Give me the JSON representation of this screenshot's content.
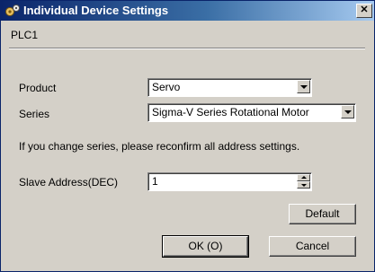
{
  "window": {
    "title": "Individual Device Settings",
    "close_glyph": "✕"
  },
  "plc_name": "PLC1",
  "product": {
    "label": "Product",
    "value": "Servo"
  },
  "series": {
    "label": "Series",
    "value": "Sigma-V Series Rotational Motor"
  },
  "info_text": "If you change series, please reconfirm all address settings.",
  "slave_address": {
    "label": "Slave Address(DEC)",
    "value": "1"
  },
  "buttons": {
    "default": "Default",
    "ok": "OK (O)",
    "cancel": "Cancel"
  },
  "colors": {
    "titlebar_start": "#0a246a",
    "titlebar_end": "#a6caf0",
    "dialog_face": "#d4d0c8"
  },
  "icons": {
    "title": "settings-gear-icon"
  }
}
